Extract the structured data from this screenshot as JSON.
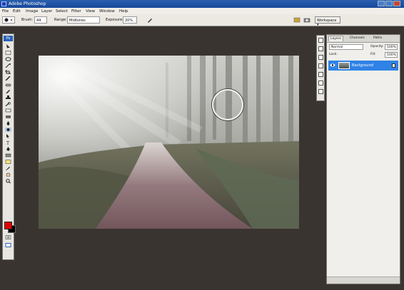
{
  "window": {
    "title": "Adobe Photoshop"
  },
  "menu": [
    "File",
    "Edit",
    "Image",
    "Layer",
    "Select",
    "Filter",
    "View",
    "Window",
    "Help"
  ],
  "options": {
    "brush_label": "Brush:",
    "brush_size": "44",
    "range_label": "Range:",
    "range_value": "Midtones",
    "exposure_label": "Exposure:",
    "exposure_value": "20%",
    "workspace_label": "Workspace"
  },
  "toolbox": {
    "logo": "Ps"
  },
  "layers_panel": {
    "tabs": [
      "Layers",
      "Channels",
      "Paths"
    ],
    "blend_mode": "Normal",
    "opacity_label": "Opacity:",
    "opacity_value": "100%",
    "lock_label": "Lock:",
    "fill_label": "Fill:",
    "fill_value": "100%",
    "layer_name": "Background"
  },
  "colors": {
    "foreground": "#e40000",
    "background": "#000000",
    "selection": "#2f82e6"
  }
}
